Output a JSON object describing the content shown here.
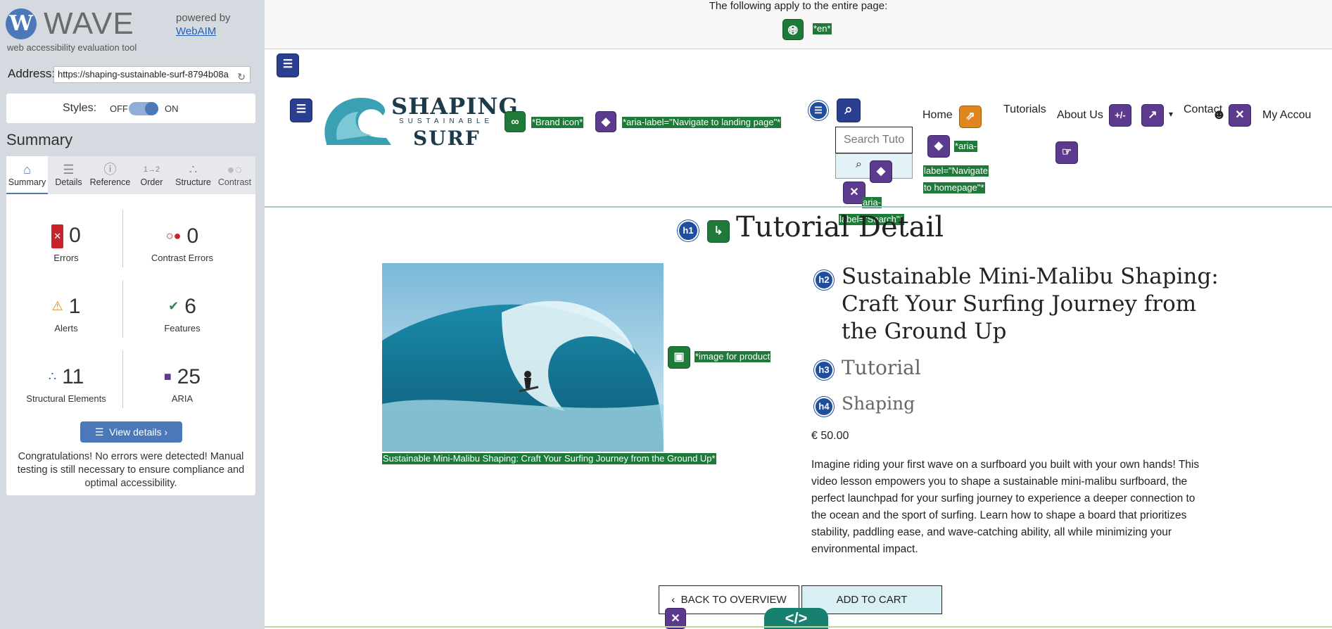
{
  "wave": {
    "logo_letter": "W",
    "logo_word": "WAVE",
    "subtitle": "web accessibility evaluation tool",
    "powered_by": "powered by",
    "webaim_link": "WebAIM",
    "address_label": "Address:",
    "address_value": "https://shaping-sustainable-surf-8794b08a",
    "styles_label": "Styles:",
    "styles_off": "OFF",
    "styles_on": "ON",
    "summary_title": "Summary",
    "tabs": [
      {
        "label": "Summary",
        "icon": "home-icon"
      },
      {
        "label": "Details",
        "icon": "list-icon"
      },
      {
        "label": "Reference",
        "icon": "info-icon"
      },
      {
        "label": "Order",
        "icon": "order-icon"
      },
      {
        "label": "Structure",
        "icon": "structure-icon"
      },
      {
        "label": "Contrast",
        "icon": "contrast-icon"
      }
    ],
    "stats": {
      "errors": {
        "value": "0",
        "label": "Errors"
      },
      "contrast_errors": {
        "value": "0",
        "label": "Contrast Errors"
      },
      "alerts": {
        "value": "1",
        "label": "Alerts"
      },
      "features": {
        "value": "6",
        "label": "Features"
      },
      "structural": {
        "value": "11",
        "label": "Structural Elements"
      },
      "aria": {
        "value": "25",
        "label": "ARIA"
      }
    },
    "view_details": "View details ›",
    "congrats": "Congratulations! No errors were detected! Manual testing is still necessary to ensure compliance and optimal accessibility."
  },
  "page": {
    "applies_text": "The following apply to the entire page:",
    "lang_tag": "*en*",
    "brand_tag": "*Brand icon*",
    "landing_tag": "*aria-label=\"Navigate to landing page\"*",
    "brand": {
      "shaping": "SHAPING",
      "sustainable": "SUSTAINABLE",
      "surf": "SURF"
    },
    "nav": {
      "home": "Home",
      "tutorials": "Tutorials",
      "about": "About Us",
      "contact": "Contact",
      "account": "My Accou"
    },
    "search_placeholder": "Search Tuto",
    "homepage_tag_lines": [
      "*aria-",
      "label=\"Navigate",
      "to homepage\"*"
    ],
    "search_tag_lines": [
      "aria-",
      "label=\"Search\"*"
    ],
    "h1": "Tutorial Detail",
    "image_tag": "*image for product",
    "image_caption": "Sustainable Mini-Malibu Shaping: Craft Your Surfing Journey from the Ground Up*",
    "h2": "Sustainable Mini-Malibu Shaping: Craft Your Surfing Journey from the Ground Up",
    "h3": "Tutorial",
    "h4": "Shaping",
    "price": "€ 50.00",
    "description": "Imagine riding your first wave on a surfboard you built with your own hands! This video lesson empowers you to shape a sustainable mini-malibu surfboard, the perfect launchpad for your surfing journey to experience a deeper connection to the ocean and the sport of surfing. Learn how to shape a board that prioritizes stability, paddling ease, and wave-catching ability, all while minimizing your environmental impact.",
    "back_button": "BACK TO OVERVIEW",
    "cart_button": "ADD TO CART",
    "badges": {
      "h1": "h1",
      "h2": "h2",
      "h3": "h3",
      "h4": "h4",
      "plusminus": "+/-"
    }
  }
}
